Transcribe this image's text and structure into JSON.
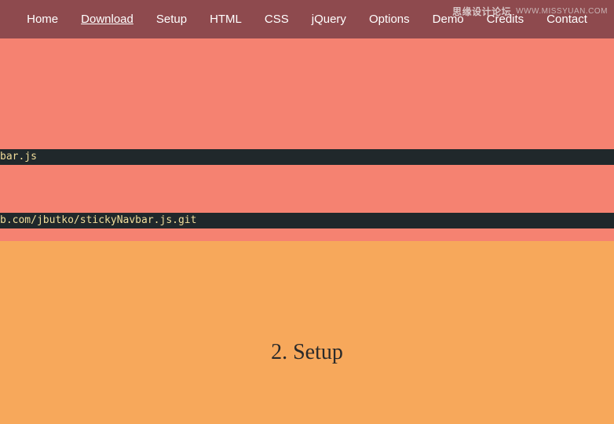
{
  "nav": {
    "items": [
      {
        "label": "Home",
        "active": false
      },
      {
        "label": "Download",
        "active": true
      },
      {
        "label": "Setup",
        "active": false
      },
      {
        "label": "HTML",
        "active": false
      },
      {
        "label": "CSS",
        "active": false
      },
      {
        "label": "jQuery",
        "active": false
      },
      {
        "label": "Options",
        "active": false
      },
      {
        "label": "Demo",
        "active": false
      },
      {
        "label": "Credits",
        "active": false
      },
      {
        "label": "Contact",
        "active": false
      }
    ]
  },
  "download": {
    "code_line_1": "bar.js",
    "code_line_2": "b.com/jbutko/stickyNavbar.js.git"
  },
  "setup": {
    "heading": "2. Setup"
  },
  "watermark": {
    "cn": "思缘设计论坛",
    "url": "WWW.MISSYUAN.COM"
  }
}
